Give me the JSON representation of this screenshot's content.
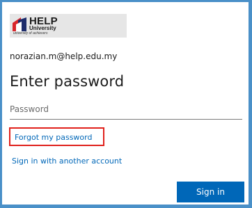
{
  "logo": {
    "title": "HELP",
    "subtitle": "University",
    "tagline": "university of achievers",
    "colors": {
      "red": "#d8262b",
      "navy": "#1d2c6b"
    }
  },
  "account": {
    "email": "norazian.m@help.edu.my"
  },
  "page": {
    "title": "Enter password"
  },
  "password": {
    "placeholder": "Password",
    "value": ""
  },
  "links": {
    "forgot": "Forgot my password",
    "another_account": "Sign in with another account"
  },
  "actions": {
    "sign_in": "Sign in"
  },
  "colors": {
    "accent": "#0067b8",
    "highlight_box": "#e0201b",
    "frame": "#4a90c8"
  }
}
